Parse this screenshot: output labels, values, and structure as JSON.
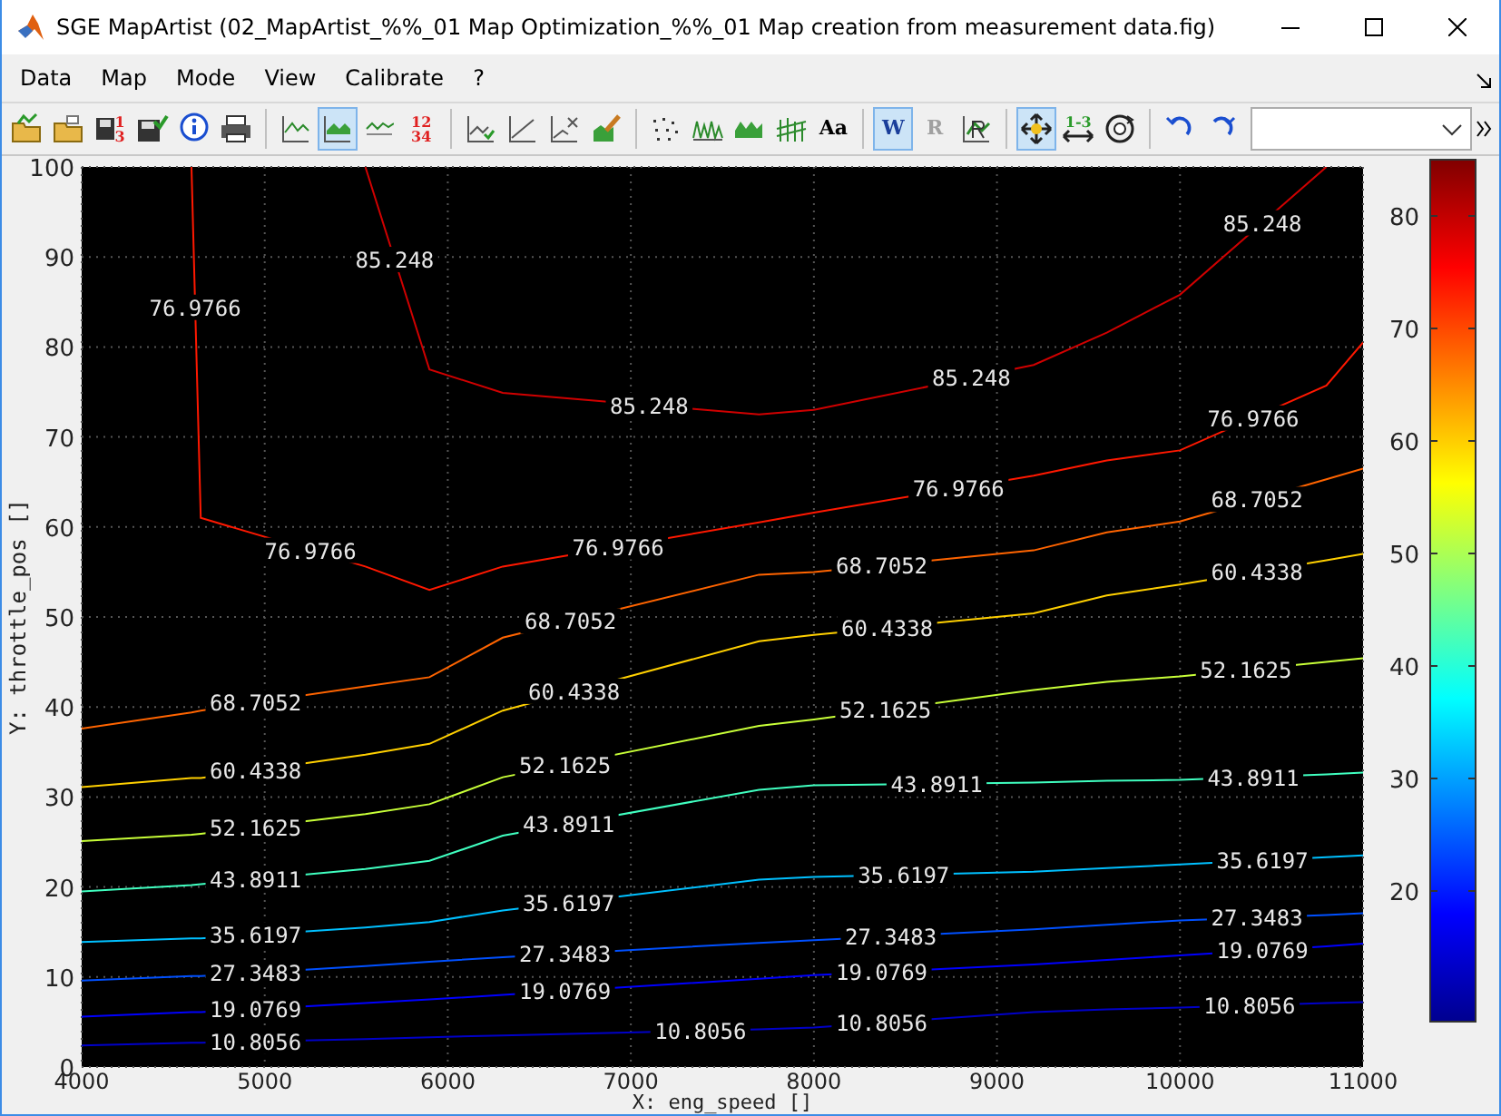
{
  "window": {
    "title": "SGE MapArtist (02_MapArtist_%%_01 Map Optimization_%%_01 Map creation from measurement data.fig)"
  },
  "menu": [
    "Data",
    "Map",
    "Mode",
    "View",
    "Calibrate",
    "?"
  ],
  "toolbar": [
    [
      {
        "selected": false
      },
      {
        "selected": false
      },
      {
        "selected": false,
        "label": "1\n3"
      },
      {
        "selected": false
      },
      {
        "selected": false
      },
      {
        "selected": false
      }
    ],
    [
      {
        "selected": false
      },
      {
        "selected": true
      },
      {
        "selected": false
      },
      {
        "selected": false,
        "label": "12\n34"
      }
    ],
    [
      {
        "selected": false
      },
      {
        "selected": false
      },
      {
        "selected": false
      },
      {
        "selected": false
      }
    ],
    [
      {
        "selected": false
      },
      {
        "selected": false
      },
      {
        "selected": false
      },
      {
        "selected": false
      },
      {
        "selected": false,
        "label": "Aa"
      }
    ],
    [
      {
        "selected": true,
        "label": "W",
        "disabled": false
      },
      {
        "selected": false,
        "label": "R",
        "disabled": true
      },
      {
        "selected": false
      }
    ],
    [
      {
        "selected": true
      },
      {
        "selected": false,
        "label": "1-3"
      },
      {
        "selected": false
      }
    ],
    [
      {
        "selected": false
      },
      {
        "selected": false
      }
    ]
  ],
  "chart": {
    "chart_data": {
      "type": "line",
      "xlabel": "X: eng_speed []",
      "ylabel": "Y: throttle_pos []",
      "grid": true,
      "x": [
        4000,
        4600,
        4650,
        5550,
        5900,
        6300,
        7700,
        8000,
        9200,
        9600,
        10000,
        10800,
        11000
      ],
      "xlim": [
        4000,
        11000
      ],
      "ylim": [
        0,
        100
      ],
      "xticks": [
        4000,
        5000,
        6000,
        7000,
        8000,
        9000,
        10000,
        11000
      ],
      "yticks": [
        0,
        10,
        20,
        30,
        40,
        50,
        60,
        70,
        80,
        90,
        100
      ],
      "series": [
        {
          "color": "#0000c8",
          "values": [
            2.4,
            2.7,
            2.7,
            3.1,
            3.3,
            3.5,
            4.2,
            4.4,
            6.1,
            6.4,
            6.6,
            7.1,
            7.2
          ]
        },
        {
          "color": "#0000ff",
          "values": [
            5.6,
            6.1,
            6.1,
            7.1,
            7.5,
            8.0,
            9.8,
            10.2,
            11.4,
            11.9,
            12.4,
            13.4,
            13.7
          ]
        },
        {
          "color": "#0050ff",
          "values": [
            9.6,
            10.1,
            10.1,
            11.2,
            11.7,
            12.2,
            13.8,
            14.1,
            15.3,
            15.8,
            16.3,
            16.9,
            17.1
          ]
        },
        {
          "color": "#00c0ff",
          "values": [
            13.9,
            14.3,
            14.3,
            15.5,
            16.1,
            17.4,
            20.8,
            21.1,
            21.7,
            22.1,
            22.5,
            23.3,
            23.5
          ]
        },
        {
          "color": "#40ffc0",
          "values": [
            19.5,
            20.2,
            20.3,
            22.0,
            22.9,
            25.7,
            30.8,
            31.3,
            31.6,
            31.8,
            31.9,
            32.5,
            32.7
          ]
        },
        {
          "color": "#c8ff38",
          "values": [
            25.1,
            25.8,
            25.9,
            28.1,
            29.2,
            32.2,
            37.9,
            38.6,
            41.9,
            42.8,
            43.4,
            45.0,
            45.4
          ]
        },
        {
          "color": "#ffd000",
          "values": [
            31.1,
            32.1,
            32.1,
            34.7,
            35.9,
            39.6,
            47.3,
            48.0,
            50.4,
            52.4,
            53.6,
            56.3,
            57.0
          ]
        },
        {
          "color": "#ff6400",
          "values": [
            37.6,
            39.4,
            39.6,
            42.3,
            43.3,
            47.7,
            54.7,
            55.0,
            57.4,
            59.4,
            60.6,
            65.3,
            66.5
          ]
        },
        {
          "color": "#ff1800",
          "values": [
            null,
            100,
            61,
            55.6,
            53,
            55.6,
            60.5,
            61.6,
            65.7,
            67.4,
            68.5,
            75.7,
            80.5
          ]
        },
        {
          "color": "#d00000",
          "values": [
            null,
            null,
            null,
            100,
            77.5,
            74.9,
            72.5,
            73,
            78.0,
            81.6,
            85.8,
            100,
            null
          ]
        }
      ],
      "annotations": [
        "10.8056",
        "10.8056",
        "10.8056",
        "10.8056",
        "19.0769",
        "19.0769",
        "19.0769",
        "19.0769",
        "27.3483",
        "27.3483",
        "27.3483",
        "27.3483",
        "35.6197",
        "35.6197",
        "35.6197",
        "35.6197",
        "43.8911",
        "43.8911",
        "43.8911",
        "43.8911",
        "52.1625",
        "52.1625",
        "52.1625",
        "52.1625",
        "60.4338",
        "60.4338",
        "60.4338",
        "60.4338",
        "68.7052",
        "68.7052",
        "68.7052",
        "68.7052",
        "76.9766",
        "76.9766",
        "76.9766",
        "76.9766",
        "76.9766",
        "85.248",
        "85.248",
        "85.248",
        "85.248"
      ]
    },
    "colorbar": {
      "ticks": [
        "80",
        "70",
        "60",
        "50",
        "40",
        "30",
        "20"
      ]
    }
  }
}
